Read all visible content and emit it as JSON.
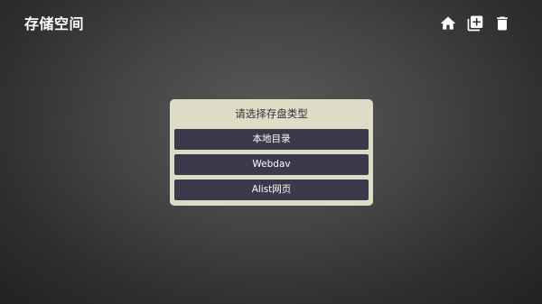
{
  "header": {
    "title": "存储空间",
    "actions": [
      {
        "name": "home-icon"
      },
      {
        "name": "add-icon"
      },
      {
        "name": "delete-icon"
      }
    ]
  },
  "dialog": {
    "title": "请选择存盘类型",
    "options": [
      {
        "label": "本地目录"
      },
      {
        "label": "Webdav"
      },
      {
        "label": "Alist网页"
      }
    ]
  },
  "colors": {
    "dialog_bg": "#dedbc6",
    "option_bg": "#3b3a4a"
  }
}
